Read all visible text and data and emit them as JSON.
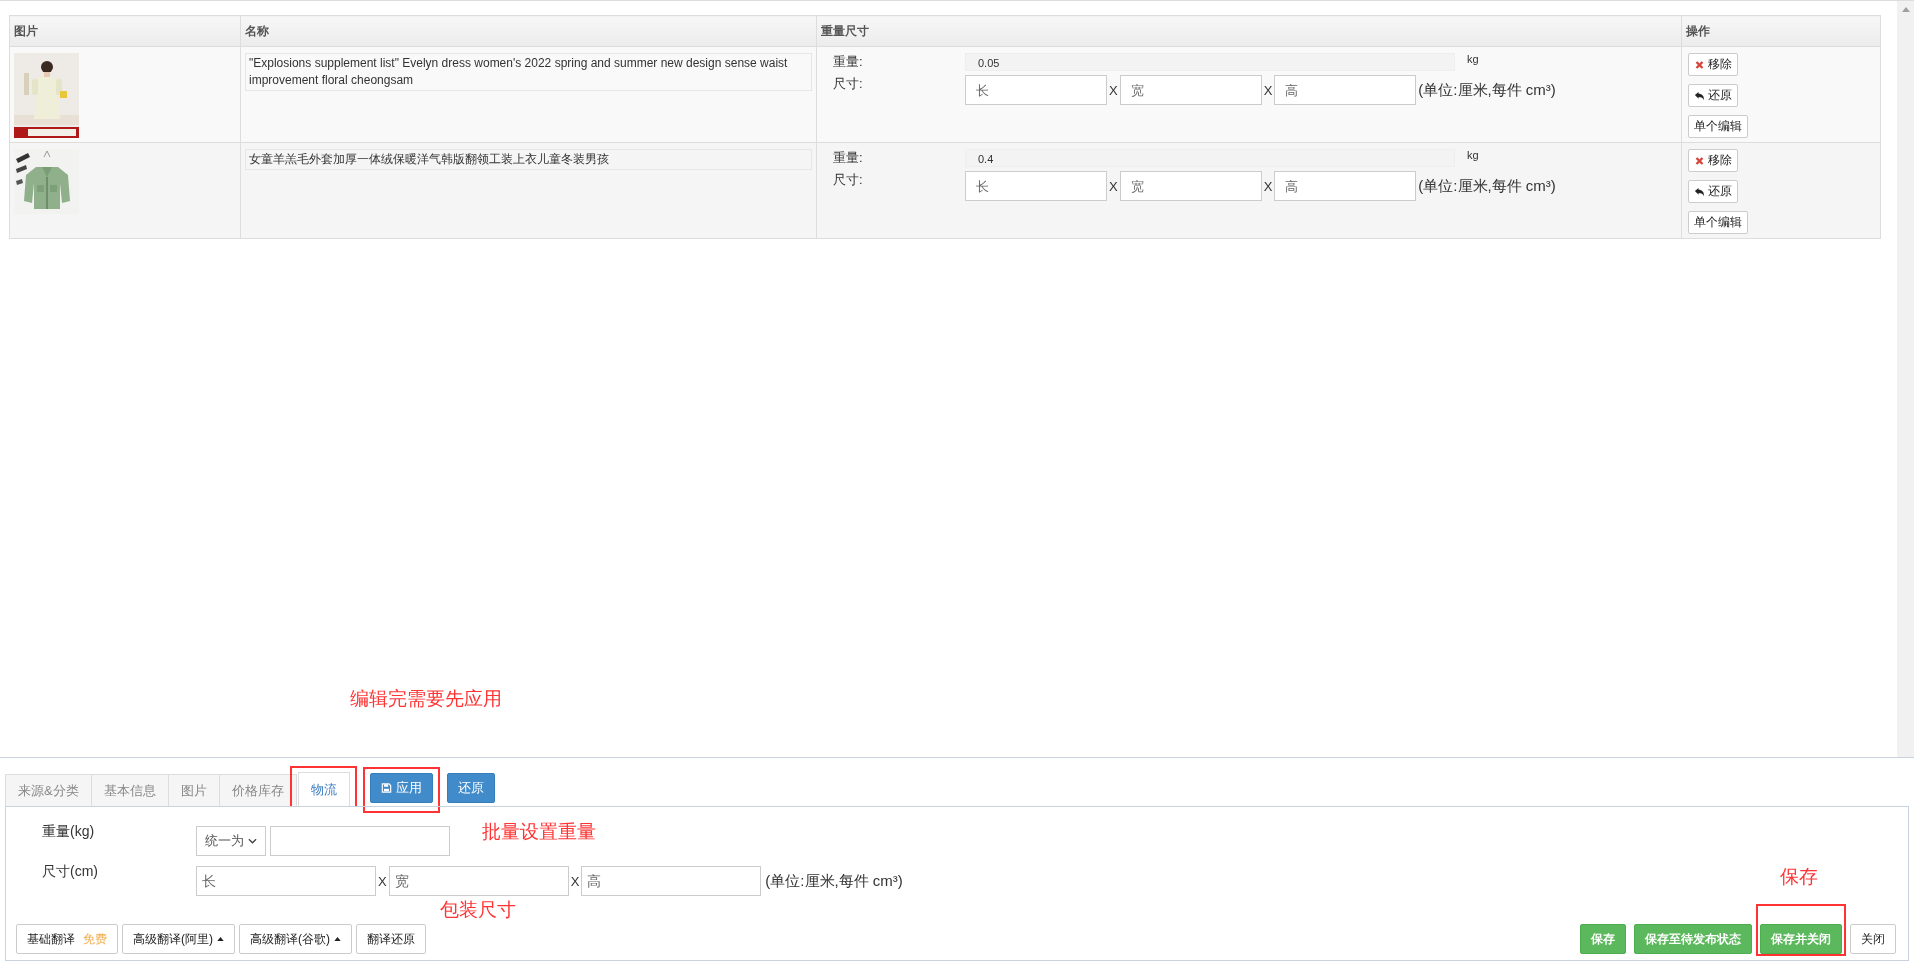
{
  "table": {
    "columns": [
      "图片",
      "名称",
      "重量尺寸",
      "操作"
    ],
    "rows": [
      {
        "picture": {
          "kind": "picture"
        },
        "name": "\"Explosions supplement list\" Evelyn dress women's 2022 spring and summer new design sense waist improvement floral cheongsam",
        "weight_label": "重量:",
        "weight": "0.05",
        "weight_unit": "kg",
        "size_label": "尺寸:",
        "size_placeholders": [
          "长",
          "宽",
          "高"
        ],
        "separators": [
          "X",
          "X"
        ],
        "size_note": "(单位:厘米,每件 cm³)",
        "actions": [
          {
            "kind": "remove",
            "label": "移除"
          },
          {
            "kind": "undo",
            "label": "还原"
          },
          {
            "kind": "plain",
            "label": "单个编辑"
          }
        ]
      },
      {
        "picture": {
          "kind": "picture"
        },
        "name": "女童羊羔毛外套加厚一体绒保暖洋气韩版翻领工装上衣儿童冬装男孩",
        "weight_label": "重量:",
        "weight": "0.4",
        "weight_unit": "kg",
        "size_label": "尺寸:",
        "size_placeholders": [
          "长",
          "宽",
          "高"
        ],
        "separators": [
          "X",
          "X"
        ],
        "size_note": "(单位:厘米,每件 cm³)",
        "actions": [
          {
            "kind": "remove",
            "label": "移除"
          },
          {
            "kind": "undo",
            "label": "还原"
          },
          {
            "kind": "plain",
            "label": "单个编辑"
          }
        ]
      }
    ]
  },
  "apply_note": "编辑完需要先应用",
  "tabs": [
    {
      "label": "来源&分类",
      "selected": false,
      "highlighted": false
    },
    {
      "label": "基本信息",
      "selected": false,
      "highlighted": false
    },
    {
      "label": "图片",
      "selected": false,
      "highlighted": false
    },
    {
      "label": "价格库存",
      "selected": false,
      "highlighted": false
    },
    {
      "label": "物流",
      "selected": true,
      "highlighted": true
    }
  ],
  "tab_buttons": [
    {
      "kind": "save",
      "label": "应用",
      "highlighted": true
    },
    {
      "kind": "plain",
      "label": "还原",
      "highlighted": false
    }
  ],
  "form": {
    "weight_label": "重量(kg)",
    "weight_mode": "统一为",
    "weight_note": "批量设置重量",
    "size_label": "尺寸(cm)",
    "size_placeholders": [
      "长",
      "宽",
      "高"
    ],
    "separators": [
      "X",
      "X"
    ],
    "size_note": "(单位:厘米,每件 cm³)",
    "size_annotation": "包装尺寸"
  },
  "translate_buttons": [
    {
      "kind": "tagged",
      "label": "基础翻译",
      "tag": "免费"
    },
    {
      "kind": "dropdown",
      "label": "高级翻译(阿里)"
    },
    {
      "kind": "dropdown",
      "label": "高级翻译(谷歌)"
    },
    {
      "kind": "plain",
      "label": "翻译还原"
    }
  ],
  "save_note": "保存",
  "action_buttons": [
    {
      "kind": "primary",
      "label": "保存",
      "highlighted": false
    },
    {
      "kind": "primary",
      "label": "保存至待发布状态",
      "highlighted": false
    },
    {
      "kind": "primary",
      "label": "保存并关闭",
      "highlighted": true
    },
    {
      "kind": "plain",
      "label": "关闭",
      "highlighted": false
    }
  ]
}
